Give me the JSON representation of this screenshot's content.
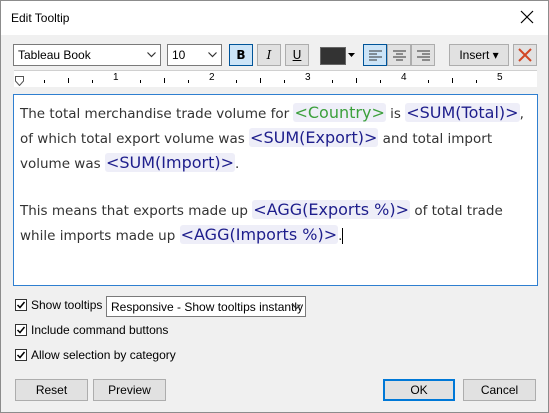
{
  "window": {
    "title": "Edit Tooltip"
  },
  "toolbar": {
    "font_name": "Tableau Book",
    "font_size": "10",
    "bold_label": "B",
    "italic_label": "I",
    "underline_label": "U",
    "text_color": "#333333",
    "insert_label": "Insert ▾"
  },
  "ruler": {
    "numbers": [
      "1",
      "2",
      "3",
      "4",
      "5"
    ]
  },
  "editor": {
    "p1_a": "The total merchandise trade volume for ",
    "p1_f1": "<Country>",
    "p1_b": " is ",
    "p1_f2": "<SUM(Total)>",
    "p1_c": ", of which total export volume was ",
    "p1_f3": "<SUM(Export)>",
    "p1_d": " and total import volume was ",
    "p1_f4": "<SUM(Import)>",
    "p1_e": ".",
    "p2_a": "This means that exports made up ",
    "p2_f1": "<AGG(Exports %)>",
    "p2_b": " of total trade while imports made up ",
    "p2_f2": "<AGG(Imports %)>",
    "p2_c": "."
  },
  "options": {
    "show_tooltips": {
      "label": "Show tooltips",
      "checked": true
    },
    "mode_value": "Responsive - Show tooltips instantly",
    "include_command_buttons": {
      "label": "Include command buttons",
      "checked": true
    },
    "allow_selection": {
      "label": "Allow selection by category",
      "checked": true
    }
  },
  "buttons": {
    "reset": "Reset",
    "preview": "Preview",
    "ok": "OK",
    "cancel": "Cancel"
  },
  "colors": {
    "field_text": "#1e1e8c",
    "field_dimension": "#3ca03c",
    "accent": "#0078d7"
  }
}
